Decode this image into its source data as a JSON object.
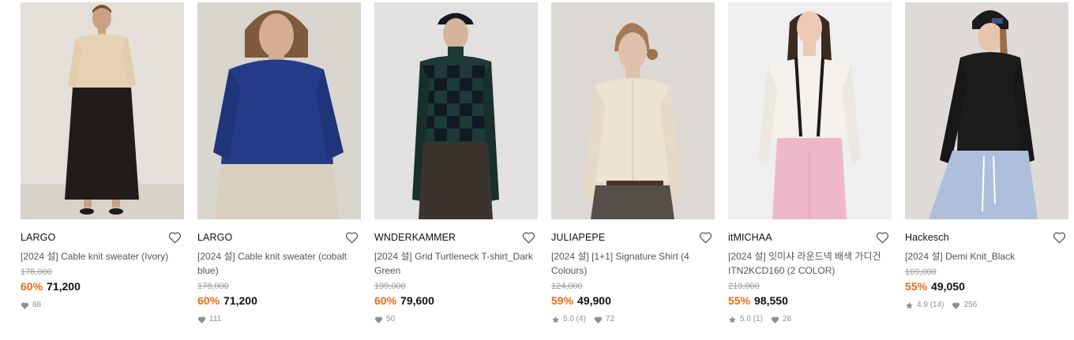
{
  "products": [
    {
      "brand": "LARGO",
      "name": "[2024 설] Cable knit sweater (Ivory)",
      "original_price": "178,000",
      "discount": "60%",
      "price": "71,200",
      "rating": "",
      "likes": "88"
    },
    {
      "brand": "LARGO",
      "name": "[2024 설] Cable knit sweater (cobalt blue)",
      "original_price": "178,000",
      "discount": "60%",
      "price": "71,200",
      "rating": "",
      "likes": "111"
    },
    {
      "brand": "WNDERKAMMER",
      "name": "[2024 설] Grid Turtleneck T-shirt_Dark Green",
      "original_price": "199,000",
      "discount": "60%",
      "price": "79,600",
      "rating": "",
      "likes": "50"
    },
    {
      "brand": "JULIAPEPE",
      "name": "[2024 설] [1+1] Signature Shirt (4 Colours)",
      "original_price": "124,000",
      "discount": "59%",
      "price": "49,900",
      "rating": "5.0 (4)",
      "likes": "72"
    },
    {
      "brand": "itMICHAA",
      "name": "[2024 설] 잇미샤 라운드넥 배색 가디건 ITN2KCD160 (2 COLOR)",
      "original_price": "219,000",
      "discount": "55%",
      "price": "98,550",
      "rating": "5.0 (1)",
      "likes": "28"
    },
    {
      "brand": "Hackesch",
      "name": "[2024 설] Demi Knit_Black",
      "original_price": "109,000",
      "discount": "55%",
      "price": "49,050",
      "rating": "4.9 (14)",
      "likes": "256"
    }
  ],
  "colors": {
    "discount": "#f06a1a",
    "meta": "#8f8f8f",
    "strike": "#9a9a9a"
  },
  "icons": {
    "wishlist": "heart-outline-icon",
    "likes": "heart-filled-icon",
    "rating": "star-icon"
  }
}
